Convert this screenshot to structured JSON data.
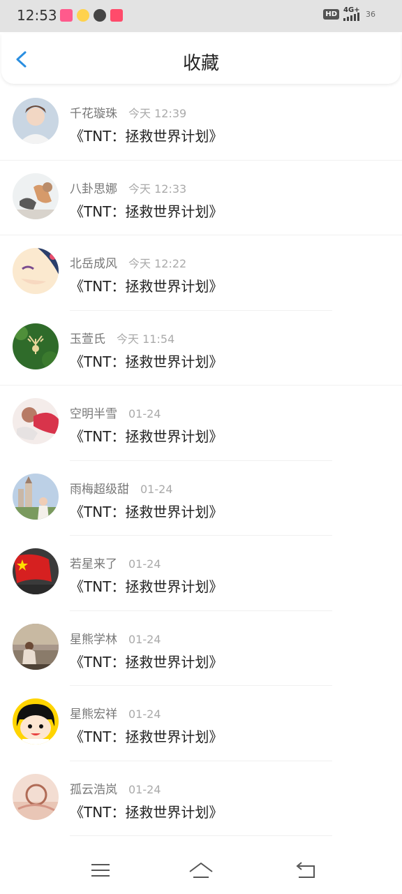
{
  "status_bar": {
    "time": "12:53",
    "hd": "HD",
    "network": "4G+",
    "battery": "36"
  },
  "header": {
    "title": "收藏",
    "back_icon": "chevron-left-icon",
    "accent": "#2a8ee0"
  },
  "items": [
    {
      "name": "千花璇珠",
      "time": "今天 12:39",
      "title": "《TNT：拯救世界计划》"
    },
    {
      "name": "八卦思娜",
      "time": "今天 12:33",
      "title": "《TNT：拯救世界计划》"
    },
    {
      "name": "北岳成风",
      "time": "今天 12:22",
      "title": "《TNT：拯救世界计划》"
    },
    {
      "name": "玉萱氏",
      "time": "今天 11:54",
      "title": "《TNT：拯救世界计划》"
    },
    {
      "name": "空明半雪",
      "time": "01-24",
      "title": "《TNT：拯救世界计划》"
    },
    {
      "name": "雨梅超级甜",
      "time": "01-24",
      "title": "《TNT：拯救世界计划》"
    },
    {
      "name": "若星来了",
      "time": "01-24",
      "title": "《TNT：拯救世界计划》"
    },
    {
      "name": "星熊学林",
      "time": "01-24",
      "title": "《TNT：拯救世界计划》"
    },
    {
      "name": "星熊宏祥",
      "time": "01-24",
      "title": "《TNT：拯救世界计划》"
    },
    {
      "name": "孤云浩岚",
      "time": "01-24",
      "title": "《TNT：拯救世界计划》"
    }
  ],
  "nav_bar": {
    "menu_icon": "menu-icon",
    "home_icon": "home-icon",
    "back_icon": "back-icon"
  }
}
